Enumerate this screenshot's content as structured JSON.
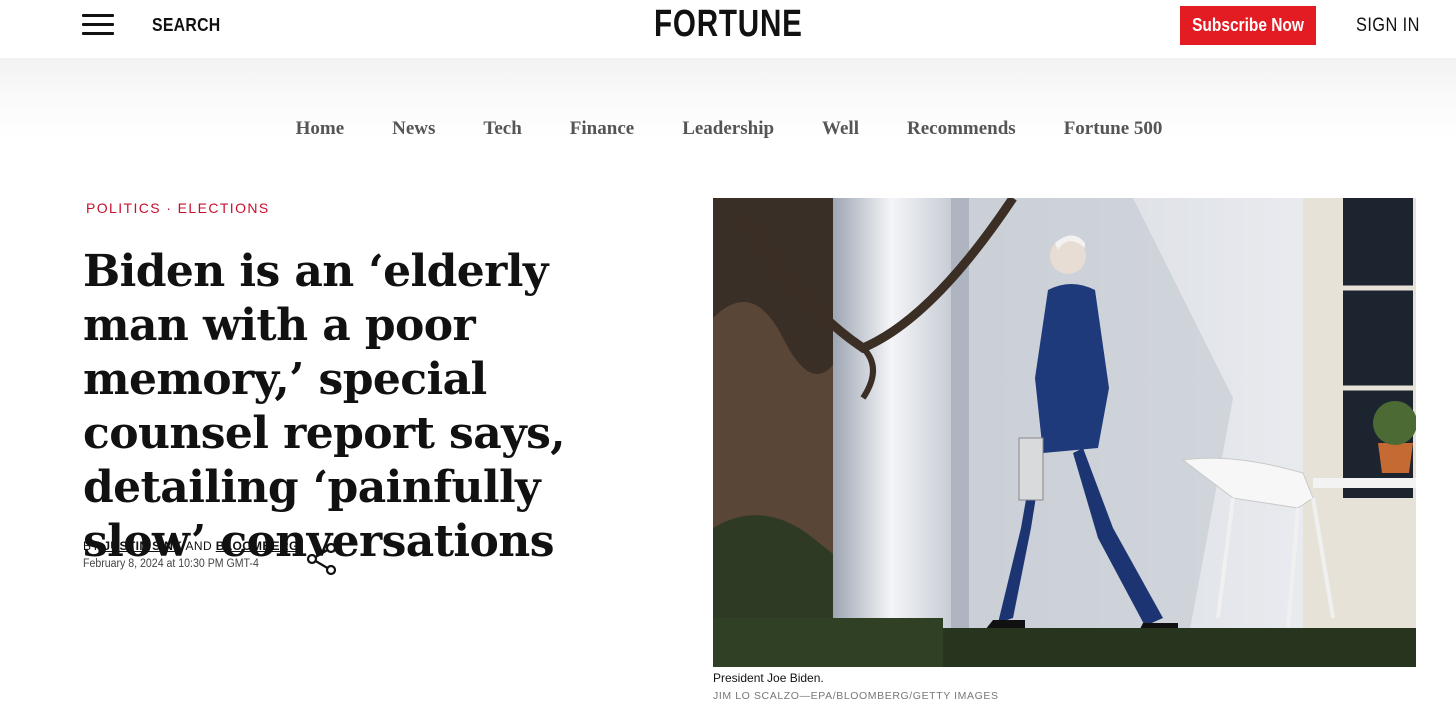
{
  "header": {
    "search_label": "SEARCH",
    "logo_text": "FORTUNE",
    "subscribe_label": "Subscribe Now",
    "signin_label": "SIGN IN",
    "accent_color": "#e31b23"
  },
  "nav": {
    "items": [
      "Home",
      "News",
      "Tech",
      "Finance",
      "Leadership",
      "Well",
      "Recommends",
      "Fortune 500"
    ]
  },
  "article": {
    "kicker_primary": "POLITICS",
    "kicker_separator": " · ",
    "kicker_secondary": "ELECTIONS",
    "headline": "Biden is an ‘elderly man with a poor memory,’ special counsel report says, detailing ‘painfully slow’ conversations",
    "byline_prefix": "BY",
    "author_1": "JUSTIN SINK",
    "byline_conjunction": "AND",
    "author_2": "BLOOMBERG",
    "date": "February 8, 2024 at 10:30 PM GMT-4"
  },
  "photo": {
    "caption": "President Joe Biden.",
    "credit": "JIM LO SCALZO—EPA/BLOOMBERG/GETTY IMAGES"
  },
  "icons": {
    "menu": "hamburger-menu-icon",
    "share": "share-icon"
  }
}
